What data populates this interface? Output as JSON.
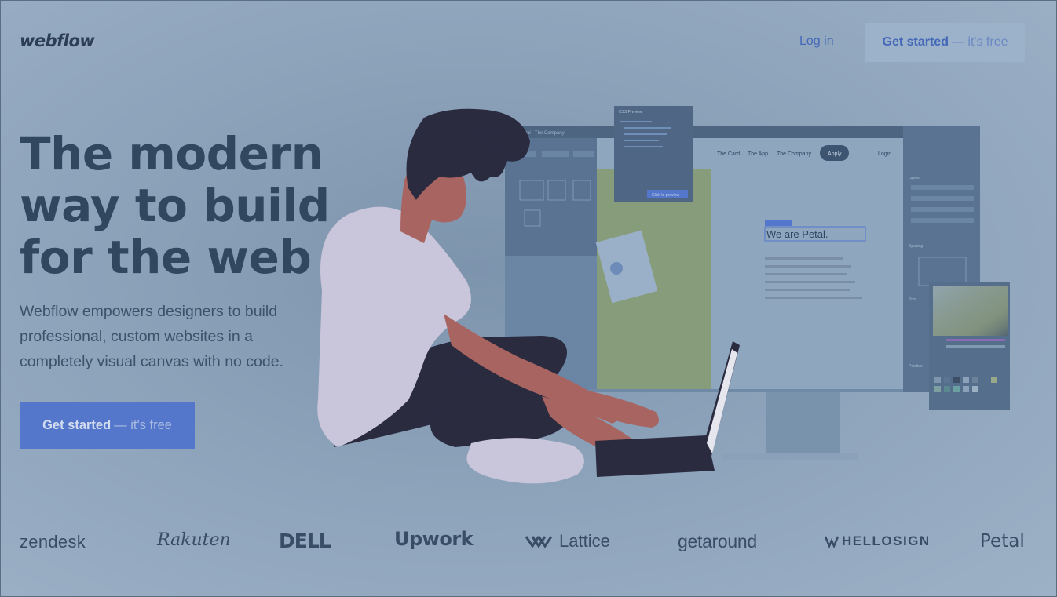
{
  "header": {
    "logo": "webflow",
    "login_label": "Log in",
    "cta_label": "Get started",
    "cta_suffix": "— it's free"
  },
  "hero": {
    "title_lines": [
      "The modern",
      "way to build",
      "for the web"
    ],
    "subtitle": "Webflow empowers designers to build professional, custom websites in a completely visual canvas with no code.",
    "cta_label": "Get started",
    "cta_suffix": "— it's free"
  },
  "editor_mock": {
    "breadcrumb": "Petal · The Company",
    "nav": [
      "The Card",
      "The App",
      "The Company"
    ],
    "apply_label": "Apply",
    "login_label": "Login",
    "headline": "We are Petal.",
    "panel_title": "CSS Preview",
    "panel_button": "Click to preview",
    "section_labels": [
      "Layout",
      "Spacing",
      "Size",
      "Position"
    ]
  },
  "customer_logos": [
    "zendesk",
    "Rakuten",
    "DELL",
    "Upwork",
    "Lattice",
    "getaround",
    "HELLOSIGN",
    "Petal"
  ],
  "colors": {
    "background": "#8fa5bc",
    "heading": "#30475f",
    "accent": "#5477cc",
    "link": "#4468b8"
  }
}
